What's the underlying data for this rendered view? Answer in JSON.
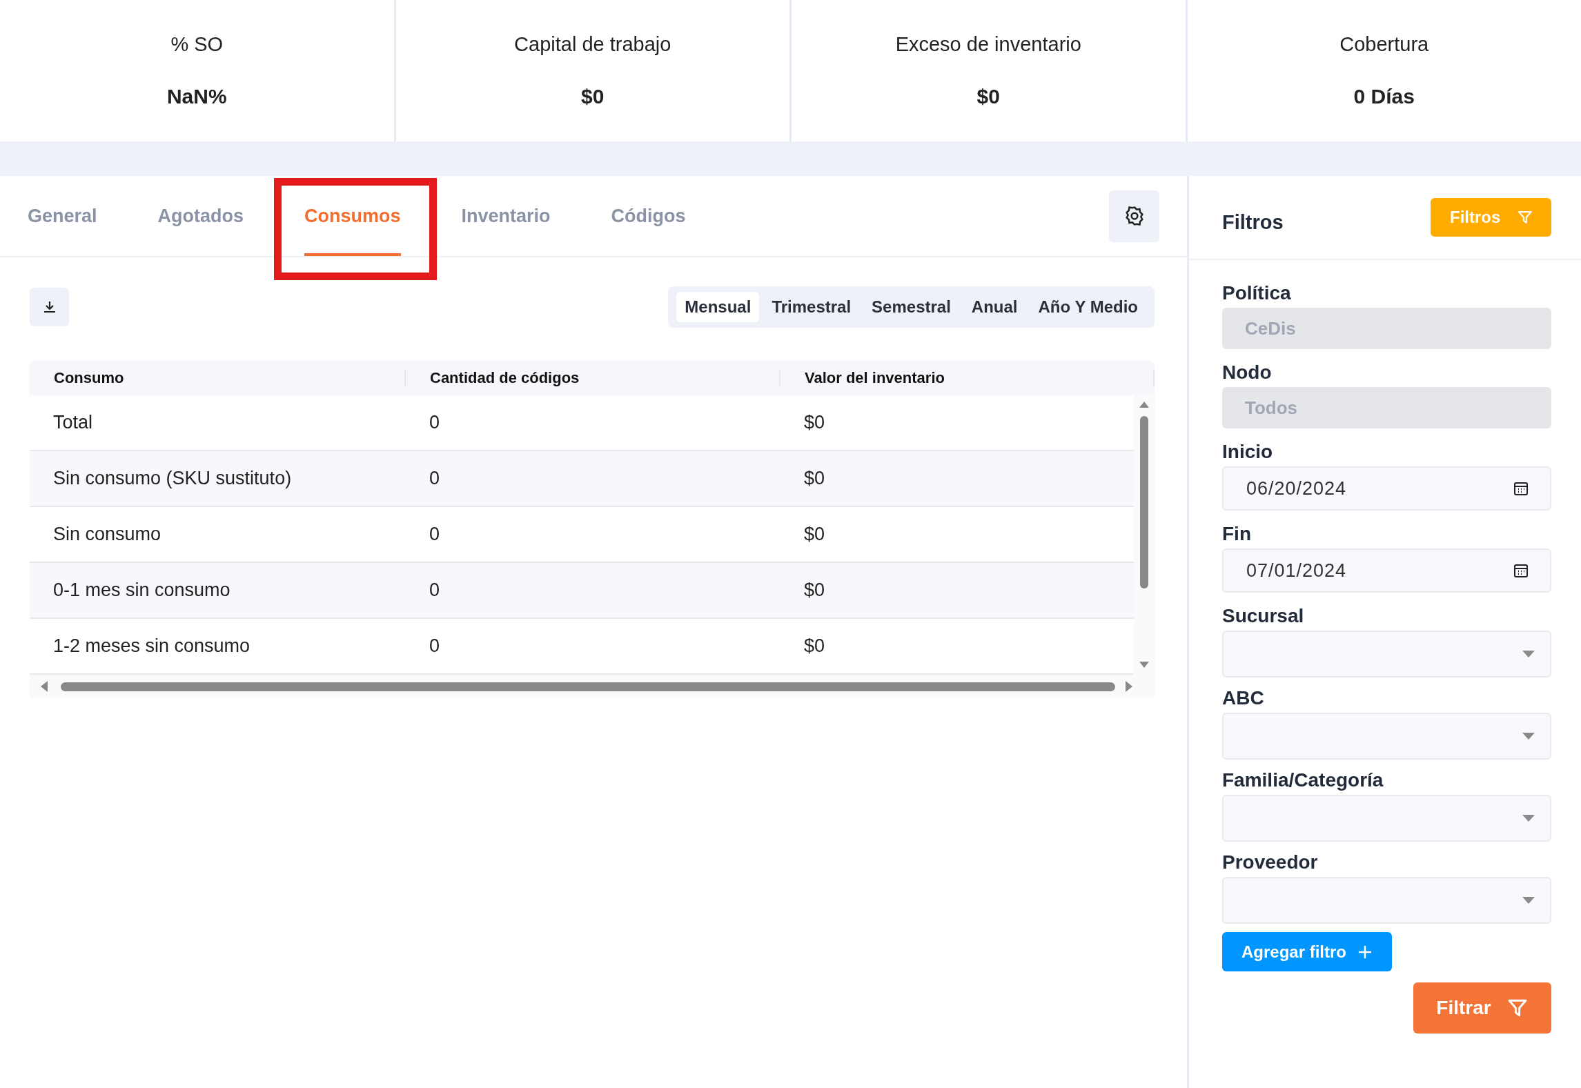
{
  "kpis": [
    {
      "label": "% SO",
      "value": "NaN%"
    },
    {
      "label": "Capital de trabajo",
      "value": "$0"
    },
    {
      "label": "Exceso de inventario",
      "value": "$0"
    },
    {
      "label": "Cobertura",
      "value": "0 Días"
    }
  ],
  "tabs": [
    {
      "label": "General",
      "selected": false,
      "highlighted": false
    },
    {
      "label": "Agotados",
      "selected": false,
      "highlighted": false
    },
    {
      "label": "Consumos",
      "selected": true,
      "highlighted": true
    },
    {
      "label": "Inventario",
      "selected": false,
      "highlighted": false
    },
    {
      "label": "Códigos",
      "selected": false,
      "highlighted": false
    }
  ],
  "periods": [
    {
      "label": "Mensual",
      "selected": true
    },
    {
      "label": "Trimestral",
      "selected": false
    },
    {
      "label": "Semestral",
      "selected": false
    },
    {
      "label": "Anual",
      "selected": false
    },
    {
      "label": "Año Y Medio",
      "selected": false
    }
  ],
  "table": {
    "columns": [
      "Consumo",
      "Cantidad de códigos",
      "Valor del inventario"
    ],
    "rows": [
      [
        "Total",
        "0",
        "$0"
      ],
      [
        "Sin consumo (SKU sustituto)",
        "0",
        "$0"
      ],
      [
        "Sin consumo",
        "0",
        "$0"
      ],
      [
        "0-1 mes sin consumo",
        "0",
        "$0"
      ],
      [
        "1-2 meses sin consumo",
        "0",
        "$0"
      ]
    ]
  },
  "filters_panel": {
    "title": "Filtros",
    "toggle_button": "Filtros",
    "fields": [
      {
        "kind": "disabled",
        "label": "Política",
        "value": "CeDis"
      },
      {
        "kind": "disabled",
        "label": "Nodo",
        "value": "Todos"
      },
      {
        "kind": "date",
        "label": "Inicio",
        "value": "06/20/2024"
      },
      {
        "kind": "date",
        "label": "Fin",
        "value": "07/01/2024"
      },
      {
        "kind": "select",
        "label": "Sucursal"
      },
      {
        "kind": "select",
        "label": "ABC"
      },
      {
        "kind": "select",
        "label": "Familia/Categoría"
      },
      {
        "kind": "select",
        "label": "Proveedor"
      }
    ],
    "add_button": "Agregar filtro",
    "apply_button": "Filtrar"
  }
}
